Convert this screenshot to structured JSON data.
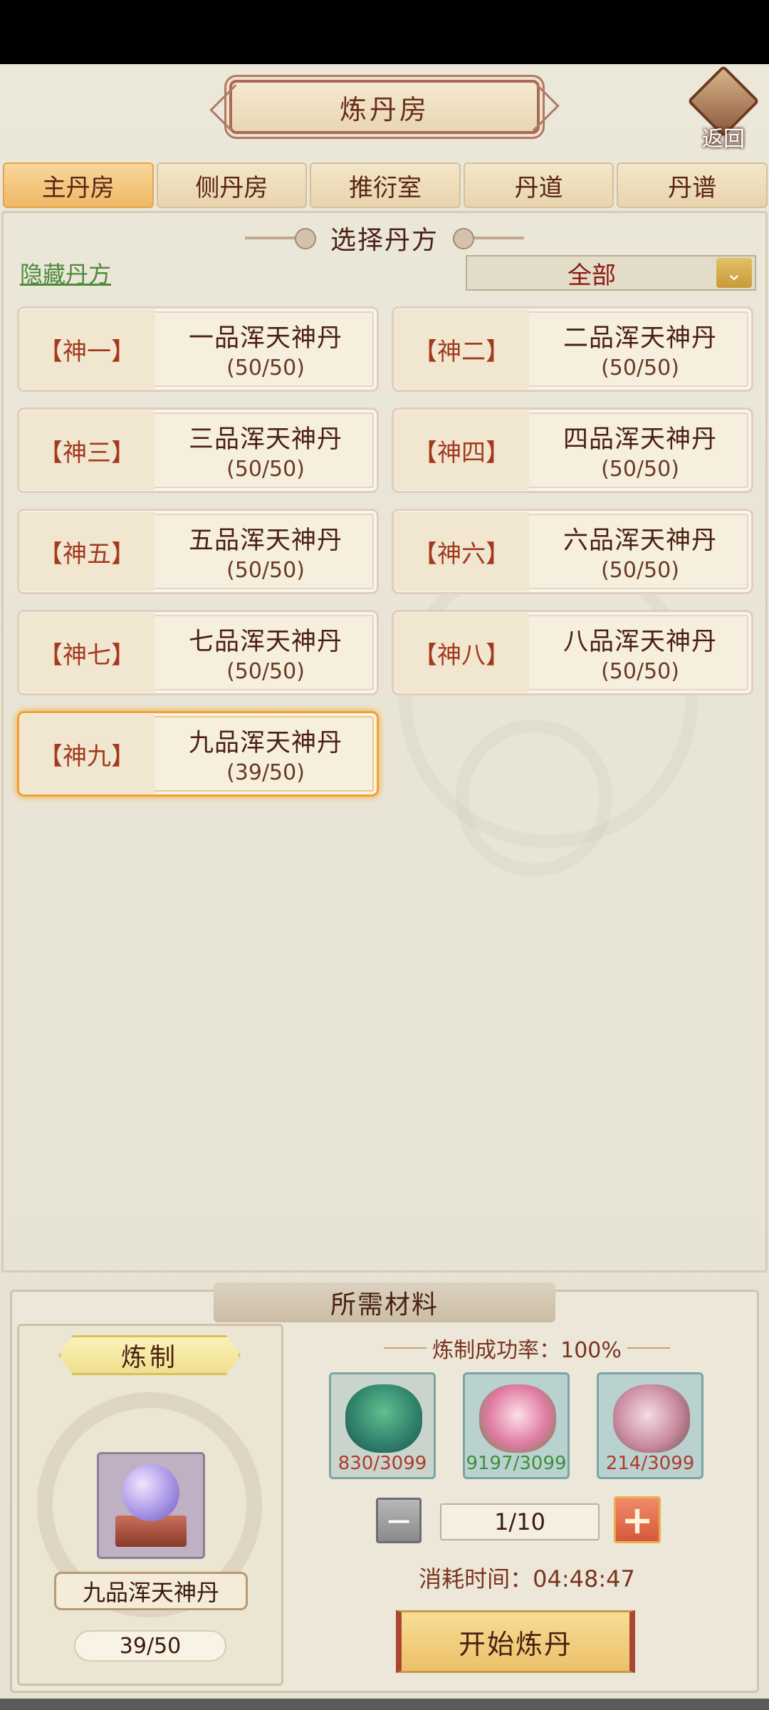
{
  "header": {
    "title": "炼丹房",
    "back_label": "返回"
  },
  "tabs": [
    {
      "label": "主丹房",
      "active": true
    },
    {
      "label": "侧丹房",
      "active": false
    },
    {
      "label": "推衍室",
      "active": false
    },
    {
      "label": "丹道",
      "active": false
    },
    {
      "label": "丹谱",
      "active": false
    }
  ],
  "recipe_section": {
    "title": "选择丹方",
    "hide_link": "隐藏丹方",
    "filter_value": "全部"
  },
  "recipes": [
    {
      "tag": "【神一】",
      "name": "一品浑天神丹",
      "count": "(50/50)"
    },
    {
      "tag": "【神二】",
      "name": "二品浑天神丹",
      "count": "(50/50)"
    },
    {
      "tag": "【神三】",
      "name": "三品浑天神丹",
      "count": "(50/50)"
    },
    {
      "tag": "【神四】",
      "name": "四品浑天神丹",
      "count": "(50/50)"
    },
    {
      "tag": "【神五】",
      "name": "五品浑天神丹",
      "count": "(50/50)"
    },
    {
      "tag": "【神六】",
      "name": "六品浑天神丹",
      "count": "(50/50)"
    },
    {
      "tag": "【神七】",
      "name": "七品浑天神丹",
      "count": "(50/50)"
    },
    {
      "tag": "【神八】",
      "name": "八品浑天神丹",
      "count": "(50/50)"
    },
    {
      "tag": "【神九】",
      "name": "九品浑天神丹",
      "count": "(39/50)",
      "selected": true
    }
  ],
  "materials": {
    "title": "所需材料",
    "craft_label": "炼制",
    "craft_item_name": "九品浑天神丹",
    "craft_progress": "39/50",
    "success_rate": "炼制成功率：100%",
    "items": [
      {
        "count": "830/3099",
        "status": "insufficient"
      },
      {
        "count": "9197/3099",
        "status": "sufficient"
      },
      {
        "count": "214/3099",
        "status": "insufficient"
      }
    ],
    "quantity": "1/10",
    "time": "消耗时间：04:48:47",
    "start_button": "开始炼丹"
  },
  "colors": {
    "accent_active_tab": "#f0b866",
    "selected_border": "#f0a030",
    "insufficient": "#b03a2a",
    "sufficient": "#3f8f3a"
  }
}
